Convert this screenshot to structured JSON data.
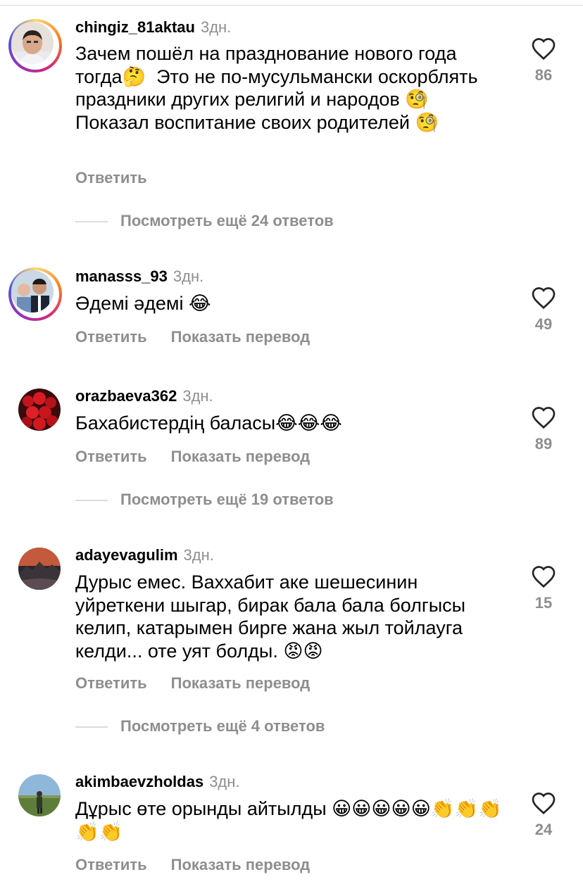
{
  "comments": [
    {
      "username": "chingiz_81aktau",
      "time": "3дн.",
      "text": "Зачем пошёл на празднование нового года тогда🤔  Это не по-мусульмански оскорблять праздники других религий и народов 🧐 Показал воспитание своих родителей 🧐",
      "reply": "Ответить",
      "translate": "",
      "likes": "86",
      "more": "Посмотреть ещё 24 ответов"
    },
    {
      "username": "manasss_93",
      "time": "3дн.",
      "text": "Әдемі әдемі 😂",
      "reply": "Ответить",
      "translate": "Показать перевод",
      "likes": "49",
      "more": ""
    },
    {
      "username": "orazbaeva362",
      "time": "3дн.",
      "text": "Бахабистердің баласы😂😂😂",
      "reply": "Ответить",
      "translate": "Показать перевод",
      "likes": "89",
      "more": "Посмотреть ещё 19 ответов"
    },
    {
      "username": "adayevagulim",
      "time": "3дн.",
      "text": "Дурыс емес. Ваххабит аке шешесинин уйреткени шыгар, бирак бала бала болгысы келип, катарымен бирге жана жыл тойлауга келди... оте уят болды. 😡😡",
      "reply": "Ответить",
      "translate": "Показать перевод",
      "likes": "15",
      "more": "Посмотреть ещё 4 ответов"
    },
    {
      "username": "akimbaevzholdas",
      "time": "3дн.",
      "text": "Дұрыс өте орынды айтылды 😀😀😀😀😀👏👏👏👏👏",
      "reply": "Ответить",
      "translate": "Показать перевод",
      "likes": "24",
      "more": ""
    }
  ],
  "icons": {
    "like": "heart-outline-icon"
  },
  "colors": {
    "secondary": "#8e8e8e",
    "divider": "#dbdbdb"
  }
}
